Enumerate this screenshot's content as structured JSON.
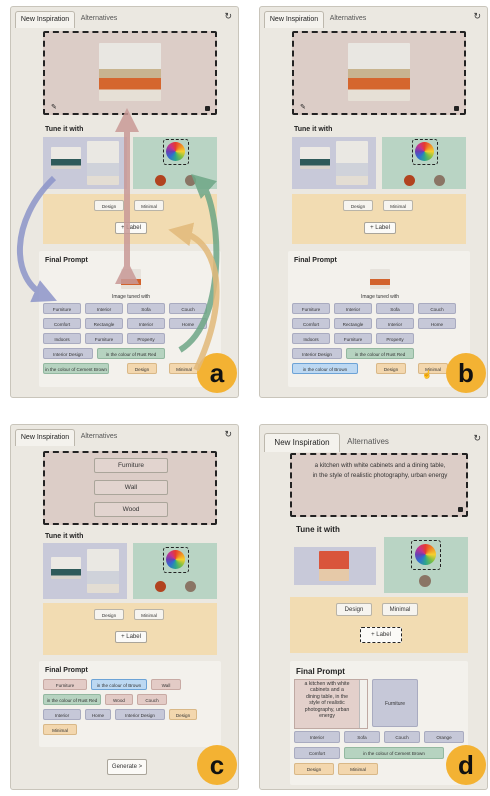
{
  "tabs": {
    "new": "New Inspiration",
    "alt": "Alternatives"
  },
  "refresh_icon": "↻",
  "sections": {
    "tune": "Tune it with",
    "final": "Final Prompt"
  },
  "labels": {
    "design": "Design",
    "minimal": "Minimal",
    "add_label": "+ Label",
    "image_tuned": "Image tuned with",
    "generate": "Generate >"
  },
  "panel_a": {
    "letter": "a",
    "chips": [
      "Furniture",
      "Interior",
      "Sofa",
      "Couch",
      "Comfort",
      "Rectangle",
      "Interior",
      "Home",
      "Indoors",
      "Furniture",
      "Property",
      "Interior Design",
      "in the colour of Rust Red",
      "in the colour of Cement Brown",
      "Design",
      "Minimal"
    ]
  },
  "panel_b": {
    "letter": "b",
    "chips": [
      "Furniture",
      "Interior",
      "Sofa",
      "Couch",
      "Comfort",
      "Rectangle",
      "Interior",
      "Home",
      "Indoors",
      "Furniture",
      "Property",
      "Interior Design",
      "in the colour of Rust Red",
      "in the colour of Brown",
      "Design",
      "Minimal"
    ]
  },
  "panel_c": {
    "letter": "c",
    "words": [
      "Furniture",
      "Wall",
      "Wood"
    ],
    "chips": [
      "Furniture",
      "in the colour of Brown",
      "Wall",
      "in the colour of Rust Red",
      "Wood",
      "Couch",
      "Interior",
      "Home",
      "Interior Design",
      "Design",
      "Minimal"
    ]
  },
  "panel_d": {
    "letter": "d",
    "prompt_line1": "a kitchen with white cabinets and a dining table,",
    "prompt_line2": "in the style of realistic photography, urban energy",
    "final_text_lines": [
      "a kitchen with white",
      "cabinets and a",
      "dining table, in the",
      "style of realistic",
      "photography, urban",
      "energy"
    ],
    "final_side_chip": "Furniture",
    "chips": [
      "Interior",
      "Sofa",
      "Couch",
      "Orange",
      "Comfort",
      "in the colour of Cement Brown",
      "Design",
      "Minimal"
    ]
  },
  "colors": {
    "rust_red": "#b1431f",
    "cement_brown": "#8a7565",
    "accent_orange": "#f3b233"
  }
}
